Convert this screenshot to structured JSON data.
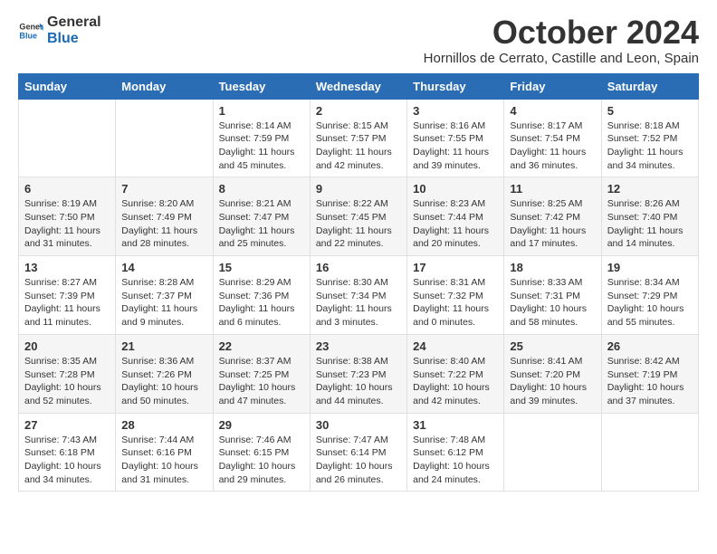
{
  "logo": {
    "line1": "General",
    "line2": "Blue"
  },
  "title": "October 2024",
  "location": "Hornillos de Cerrato, Castille and Leon, Spain",
  "weekdays": [
    "Sunday",
    "Monday",
    "Tuesday",
    "Wednesday",
    "Thursday",
    "Friday",
    "Saturday"
  ],
  "weeks": [
    [
      {
        "day": "",
        "info": ""
      },
      {
        "day": "",
        "info": ""
      },
      {
        "day": "1",
        "info": "Sunrise: 8:14 AM\nSunset: 7:59 PM\nDaylight: 11 hours and 45 minutes."
      },
      {
        "day": "2",
        "info": "Sunrise: 8:15 AM\nSunset: 7:57 PM\nDaylight: 11 hours and 42 minutes."
      },
      {
        "day": "3",
        "info": "Sunrise: 8:16 AM\nSunset: 7:55 PM\nDaylight: 11 hours and 39 minutes."
      },
      {
        "day": "4",
        "info": "Sunrise: 8:17 AM\nSunset: 7:54 PM\nDaylight: 11 hours and 36 minutes."
      },
      {
        "day": "5",
        "info": "Sunrise: 8:18 AM\nSunset: 7:52 PM\nDaylight: 11 hours and 34 minutes."
      }
    ],
    [
      {
        "day": "6",
        "info": "Sunrise: 8:19 AM\nSunset: 7:50 PM\nDaylight: 11 hours and 31 minutes."
      },
      {
        "day": "7",
        "info": "Sunrise: 8:20 AM\nSunset: 7:49 PM\nDaylight: 11 hours and 28 minutes."
      },
      {
        "day": "8",
        "info": "Sunrise: 8:21 AM\nSunset: 7:47 PM\nDaylight: 11 hours and 25 minutes."
      },
      {
        "day": "9",
        "info": "Sunrise: 8:22 AM\nSunset: 7:45 PM\nDaylight: 11 hours and 22 minutes."
      },
      {
        "day": "10",
        "info": "Sunrise: 8:23 AM\nSunset: 7:44 PM\nDaylight: 11 hours and 20 minutes."
      },
      {
        "day": "11",
        "info": "Sunrise: 8:25 AM\nSunset: 7:42 PM\nDaylight: 11 hours and 17 minutes."
      },
      {
        "day": "12",
        "info": "Sunrise: 8:26 AM\nSunset: 7:40 PM\nDaylight: 11 hours and 14 minutes."
      }
    ],
    [
      {
        "day": "13",
        "info": "Sunrise: 8:27 AM\nSunset: 7:39 PM\nDaylight: 11 hours and 11 minutes."
      },
      {
        "day": "14",
        "info": "Sunrise: 8:28 AM\nSunset: 7:37 PM\nDaylight: 11 hours and 9 minutes."
      },
      {
        "day": "15",
        "info": "Sunrise: 8:29 AM\nSunset: 7:36 PM\nDaylight: 11 hours and 6 minutes."
      },
      {
        "day": "16",
        "info": "Sunrise: 8:30 AM\nSunset: 7:34 PM\nDaylight: 11 hours and 3 minutes."
      },
      {
        "day": "17",
        "info": "Sunrise: 8:31 AM\nSunset: 7:32 PM\nDaylight: 11 hours and 0 minutes."
      },
      {
        "day": "18",
        "info": "Sunrise: 8:33 AM\nSunset: 7:31 PM\nDaylight: 10 hours and 58 minutes."
      },
      {
        "day": "19",
        "info": "Sunrise: 8:34 AM\nSunset: 7:29 PM\nDaylight: 10 hours and 55 minutes."
      }
    ],
    [
      {
        "day": "20",
        "info": "Sunrise: 8:35 AM\nSunset: 7:28 PM\nDaylight: 10 hours and 52 minutes."
      },
      {
        "day": "21",
        "info": "Sunrise: 8:36 AM\nSunset: 7:26 PM\nDaylight: 10 hours and 50 minutes."
      },
      {
        "day": "22",
        "info": "Sunrise: 8:37 AM\nSunset: 7:25 PM\nDaylight: 10 hours and 47 minutes."
      },
      {
        "day": "23",
        "info": "Sunrise: 8:38 AM\nSunset: 7:23 PM\nDaylight: 10 hours and 44 minutes."
      },
      {
        "day": "24",
        "info": "Sunrise: 8:40 AM\nSunset: 7:22 PM\nDaylight: 10 hours and 42 minutes."
      },
      {
        "day": "25",
        "info": "Sunrise: 8:41 AM\nSunset: 7:20 PM\nDaylight: 10 hours and 39 minutes."
      },
      {
        "day": "26",
        "info": "Sunrise: 8:42 AM\nSunset: 7:19 PM\nDaylight: 10 hours and 37 minutes."
      }
    ],
    [
      {
        "day": "27",
        "info": "Sunrise: 7:43 AM\nSunset: 6:18 PM\nDaylight: 10 hours and 34 minutes."
      },
      {
        "day": "28",
        "info": "Sunrise: 7:44 AM\nSunset: 6:16 PM\nDaylight: 10 hours and 31 minutes."
      },
      {
        "day": "29",
        "info": "Sunrise: 7:46 AM\nSunset: 6:15 PM\nDaylight: 10 hours and 29 minutes."
      },
      {
        "day": "30",
        "info": "Sunrise: 7:47 AM\nSunset: 6:14 PM\nDaylight: 10 hours and 26 minutes."
      },
      {
        "day": "31",
        "info": "Sunrise: 7:48 AM\nSunset: 6:12 PM\nDaylight: 10 hours and 24 minutes."
      },
      {
        "day": "",
        "info": ""
      },
      {
        "day": "",
        "info": ""
      }
    ]
  ]
}
